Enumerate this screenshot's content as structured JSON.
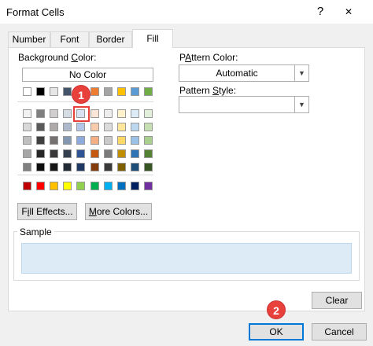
{
  "window": {
    "title": "Format Cells",
    "help_label": "?",
    "close_label": "✕"
  },
  "tabs": [
    {
      "label": "Number"
    },
    {
      "label": "Font"
    },
    {
      "label": "Border"
    },
    {
      "label": "Fill"
    }
  ],
  "background_color": {
    "label_pre": "Background ",
    "label_ul": "C",
    "label_post": "olor:",
    "no_color_label": "No Color",
    "theme_rows": [
      [
        "#ffffff",
        "#000000",
        "#e7e6e6",
        "#44546a",
        "#4472c4",
        "#ed7d31",
        "#a5a5a5",
        "#ffc000",
        "#5b9bd5",
        "#70ad47"
      ],
      [
        "#f2f2f2",
        "#7f7f7f",
        "#d0cece",
        "#d6dce4",
        "#d9e2f3",
        "#fbe5d6",
        "#ededed",
        "#fff2cc",
        "#ddebf7",
        "#e2efda"
      ],
      [
        "#d9d9d9",
        "#595959",
        "#aeaaaa",
        "#adb9ca",
        "#b4c6e7",
        "#f8cbad",
        "#dbdbdb",
        "#ffe699",
        "#bdd7ee",
        "#c6e0b4"
      ],
      [
        "#bfbfbf",
        "#404040",
        "#757171",
        "#8497b0",
        "#8ea9db",
        "#f4b084",
        "#c9c9c9",
        "#ffd966",
        "#9bc2e6",
        "#a9d08e"
      ],
      [
        "#a6a6a6",
        "#262626",
        "#3a3838",
        "#333f4f",
        "#2f5597",
        "#c65911",
        "#7b7b7b",
        "#bf8f00",
        "#2f75b5",
        "#548235"
      ],
      [
        "#808080",
        "#0d0d0d",
        "#161616",
        "#222b35",
        "#1f3864",
        "#843c0c",
        "#3a3a3a",
        "#7f6000",
        "#1f4e78",
        "#375623"
      ]
    ],
    "standard_row": [
      "#c00000",
      "#ff0000",
      "#ffc000",
      "#ffff00",
      "#92d050",
      "#00b050",
      "#00b0f0",
      "#0070c0",
      "#002060",
      "#7030a0"
    ]
  },
  "buttons": {
    "fill_effects_ul": "i",
    "fill_effects_pre": "F",
    "fill_effects_post": "ll Effects...",
    "more_colors_ul": "M",
    "more_colors_post": "ore Colors...",
    "clear_label": "Clear",
    "ok_label": "OK",
    "cancel_label": "Cancel"
  },
  "pattern_color": {
    "label_ul": "A",
    "label_pre": "P",
    "label_post": "ttern Color:",
    "value": "Automatic"
  },
  "pattern_style": {
    "label_pre": "Pattern ",
    "label_ul": "S",
    "label_post": "tyle:",
    "value": ""
  },
  "sample": {
    "label": "Sample",
    "color": "#ddebf7"
  },
  "callouts": {
    "one": "1",
    "two": "2"
  }
}
